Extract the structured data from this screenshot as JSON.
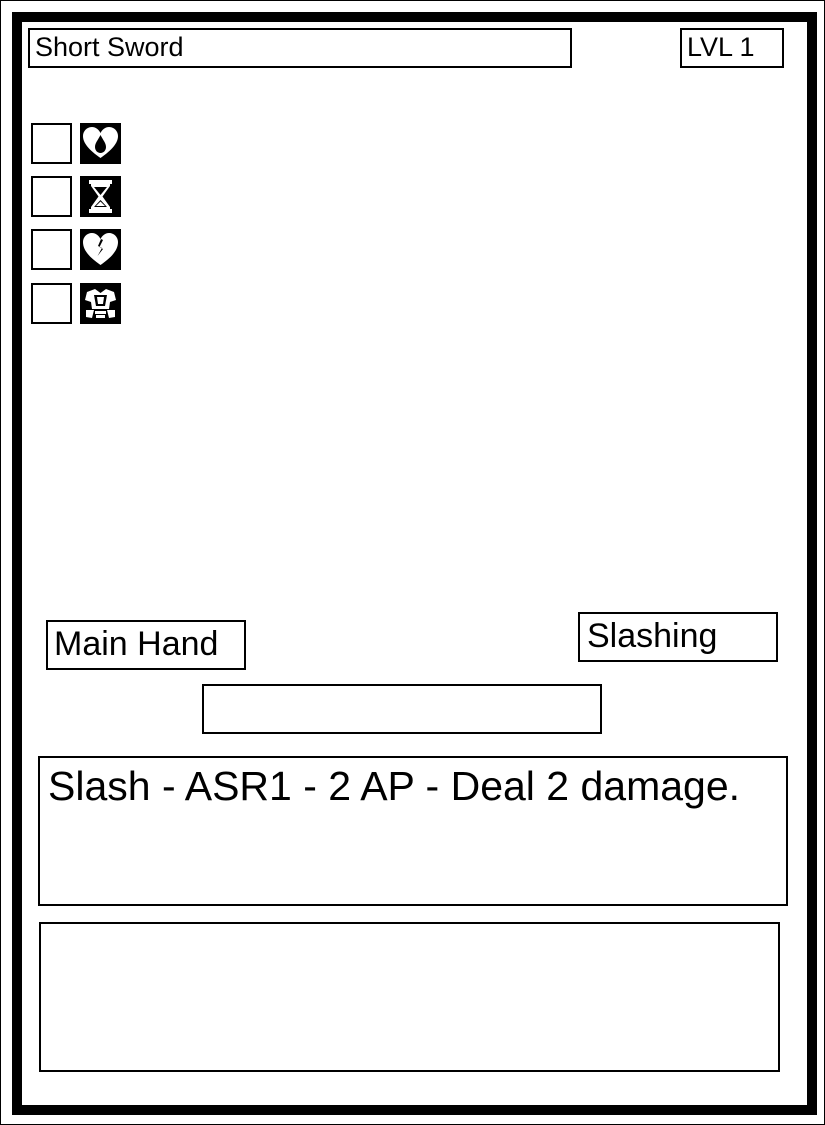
{
  "card": {
    "name": "Short Sword",
    "level": "LVL 1",
    "slot": "Main Hand",
    "damage_type": "Slashing",
    "subtitle_bar": "",
    "ability_text": "Slash - ASR1 - 2 AP - Deal 2 damage.",
    "flavor_text": ""
  },
  "status_effects": [
    {
      "icon": "bleeding-heart-icon",
      "checked": false
    },
    {
      "icon": "hourglass-icon",
      "checked": false
    },
    {
      "icon": "broken-heart-icon",
      "checked": false
    },
    {
      "icon": "armor-icon",
      "checked": false
    }
  ],
  "colors": {
    "ink": "#000000",
    "paper": "#ffffff"
  }
}
